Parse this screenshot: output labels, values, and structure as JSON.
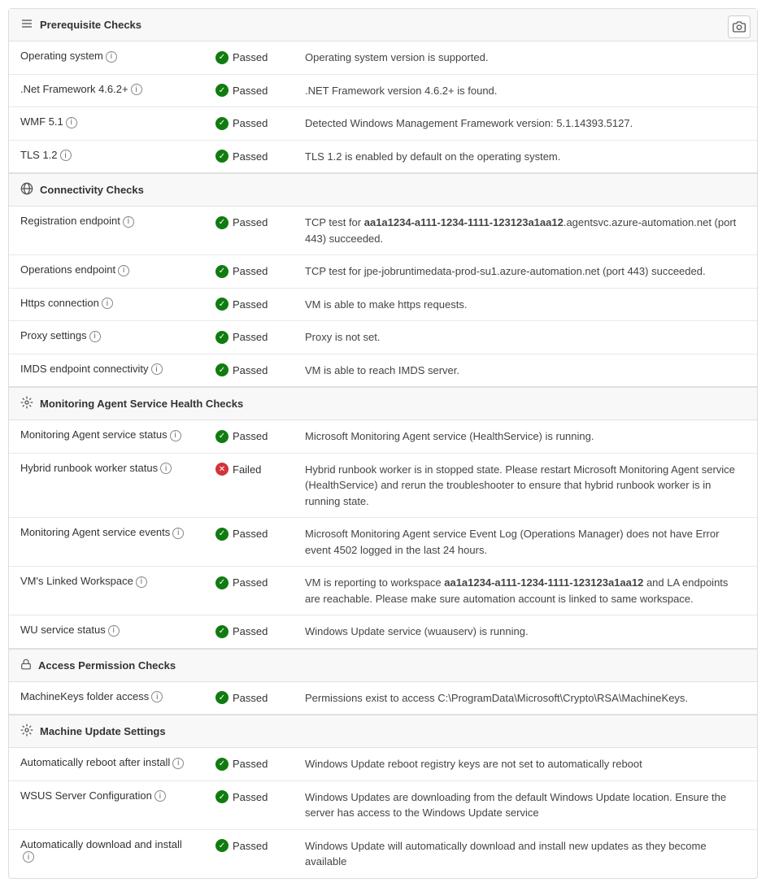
{
  "title": "Prerequisite Checks",
  "camera_icon": "📷",
  "sections": [
    {
      "id": "prerequisite",
      "title": "Prerequisite Checks",
      "icon": "≡",
      "rows": [
        {
          "check": "Operating system",
          "has_info": true,
          "status": "Passed",
          "status_type": "passed",
          "description": "Operating system version is supported."
        },
        {
          "check": ".Net Framework 4.6.2+",
          "has_info": true,
          "status": "Passed",
          "status_type": "passed",
          "description": ".NET Framework version 4.6.2+ is found."
        },
        {
          "check": "WMF 5.1",
          "has_info": true,
          "status": "Passed",
          "status_type": "passed",
          "description": "Detected Windows Management Framework version: 5.1.14393.5127."
        },
        {
          "check": "TLS 1.2",
          "has_info": true,
          "status": "Passed",
          "status_type": "passed",
          "description": "TLS 1.2 is enabled by default on the operating system."
        }
      ]
    },
    {
      "id": "connectivity",
      "title": "Connectivity Checks",
      "icon": "↗",
      "rows": [
        {
          "check": "Registration endpoint",
          "has_info": true,
          "status": "Passed",
          "status_type": "passed",
          "description": "TCP test for aa1a1234-a111-1234-1111-123123a1aa12.agentsvc.azure-automation.net (port 443) succeeded.",
          "highlight_text": "aa1a1234-a111-1234-1111-123123a1aa12"
        },
        {
          "check": "Operations endpoint",
          "has_info": true,
          "status": "Passed",
          "status_type": "passed",
          "description": "TCP test for jpe-jobruntimedata-prod-su1.azure-automation.net (port 443) succeeded."
        },
        {
          "check": "Https connection",
          "has_info": true,
          "status": "Passed",
          "status_type": "passed",
          "description": "VM is able to make https requests."
        },
        {
          "check": "Proxy settings",
          "has_info": true,
          "status": "Passed",
          "status_type": "passed",
          "description": "Proxy is not set."
        },
        {
          "check": "IMDS endpoint connectivity",
          "has_info": true,
          "status": "Passed",
          "status_type": "passed",
          "description": "VM is able to reach IMDS server."
        }
      ]
    },
    {
      "id": "monitoring",
      "title": "Monitoring Agent Service Health Checks",
      "icon": "⚙",
      "rows": [
        {
          "check": "Monitoring Agent service status",
          "has_info": true,
          "status": "Passed",
          "status_type": "passed",
          "description": "Microsoft Monitoring Agent service (HealthService) is running."
        },
        {
          "check": "Hybrid runbook worker status",
          "has_info": true,
          "status": "Failed",
          "status_type": "failed",
          "description": "Hybrid runbook worker is in stopped state. Please restart Microsoft Monitoring Agent service (HealthService) and rerun the troubleshooter to ensure that hybrid runbook worker is in running state."
        },
        {
          "check": "Monitoring Agent service events",
          "has_info": true,
          "status": "Passed",
          "status_type": "passed",
          "description": "Microsoft Monitoring Agent service Event Log (Operations Manager) does not have Error event 4502 logged in the last 24 hours."
        },
        {
          "check": "VM's Linked Workspace",
          "has_info": true,
          "status": "Passed",
          "status_type": "passed",
          "description": "VM is reporting to workspace aa1a1234-a111-1234-1111-123123a1aa12 and LA endpoints are reachable. Please make sure automation account is linked to same workspace.",
          "highlight_text": "aa1a1234-a111-1234-1111-123123a1aa12"
        },
        {
          "check": "WU service status",
          "has_info": true,
          "status": "Passed",
          "status_type": "passed",
          "description": "Windows Update service (wuauserv) is running."
        }
      ]
    },
    {
      "id": "access",
      "title": "Access Permission Checks",
      "icon": "🔒",
      "rows": [
        {
          "check": "MachineKeys folder access",
          "has_info": true,
          "status": "Passed",
          "status_type": "passed",
          "description": "Permissions exist to access C:\\ProgramData\\Microsoft\\Crypto\\RSA\\MachineKeys."
        }
      ]
    },
    {
      "id": "machine-update",
      "title": "Machine Update Settings",
      "icon": "⚙",
      "rows": [
        {
          "check": "Automatically reboot after install",
          "has_info": true,
          "status": "Passed",
          "status_type": "passed",
          "description": "Windows Update reboot registry keys are not set to automatically reboot"
        },
        {
          "check": "WSUS Server Configuration",
          "has_info": true,
          "status": "Passed",
          "status_type": "passed",
          "description": "Windows Updates are downloading from the default Windows Update location. Ensure the server has access to the Windows Update service"
        },
        {
          "check": "Automatically download and install",
          "has_info": true,
          "status": "Passed",
          "status_type": "passed",
          "description": "Windows Update will automatically download and install new updates as they become available"
        }
      ]
    }
  ]
}
